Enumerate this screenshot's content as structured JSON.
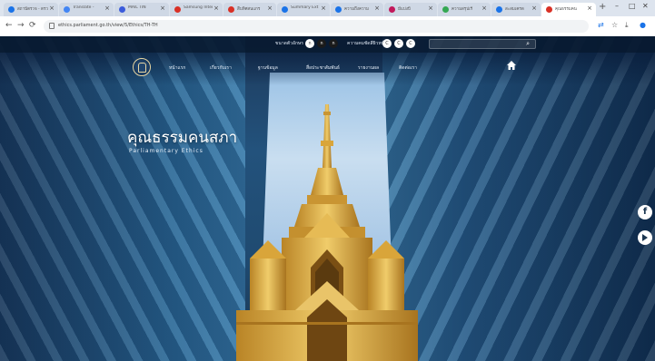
{
  "browser": {
    "tabs": [
      {
        "label": "สถานีตรวจ - ตรว",
        "favicon_color": "#1a73e8"
      },
      {
        "label": "Translate -",
        "favicon_color": "#4285f4"
      },
      {
        "label": "MAIL TIN",
        "favicon_color": "#3b5bdb"
      },
      {
        "label": "Samsung Inter",
        "favicon_color": "#d93025"
      },
      {
        "label": "สืบทิศสนแกร",
        "favicon_color": "#d93025"
      },
      {
        "label": "Summary Ext",
        "favicon_color": "#1a73e8"
      },
      {
        "label": "ความถึงความ",
        "favicon_color": "#1a73e8"
      },
      {
        "label": "มีแบ่งปี",
        "favicon_color": "#c2185b"
      },
      {
        "label": "ความสรุปเรี",
        "favicon_color": "#34a853"
      },
      {
        "label": "สะสมเครด",
        "favicon_color": "#1a73e8"
      },
      {
        "label": "คุณธรรมคน",
        "favicon_color": "#d93025",
        "active": true
      }
    ],
    "url": "ethics.parliament.go.th/view/5/Ethics/TH-TH",
    "controls": {
      "back": "←",
      "forward": "→",
      "reload": "⟳",
      "new_tab": "+",
      "minimize": "–",
      "restore": "□",
      "close": "✕"
    }
  },
  "site": {
    "accessibility": {
      "font_size_label": "ขนาดตัวอักษร",
      "font_sizes": [
        "ก",
        "ก",
        "ก"
      ],
      "contrast_label": "ความคมชัดสีผิวหน้า",
      "contrast_options": [
        "C",
        "C",
        "C"
      ]
    },
    "search": {
      "placeholder": ""
    },
    "nav": {
      "items": [
        "หน้าแรก",
        "เกี่ยวกับเรา",
        "ฐานข้อมูล",
        "สื่อประชาสัมพันธ์",
        "รายงานผล",
        "ติดต่อเรา"
      ]
    },
    "hero": {
      "title": "คุณธรรมคนสภา",
      "subtitle": "Parliamentary Ethics"
    },
    "social": {
      "facebook": "f",
      "youtube": ""
    },
    "colors": {
      "accent_gold": "#d9a53a",
      "dark_blue": "#1a3550"
    }
  }
}
